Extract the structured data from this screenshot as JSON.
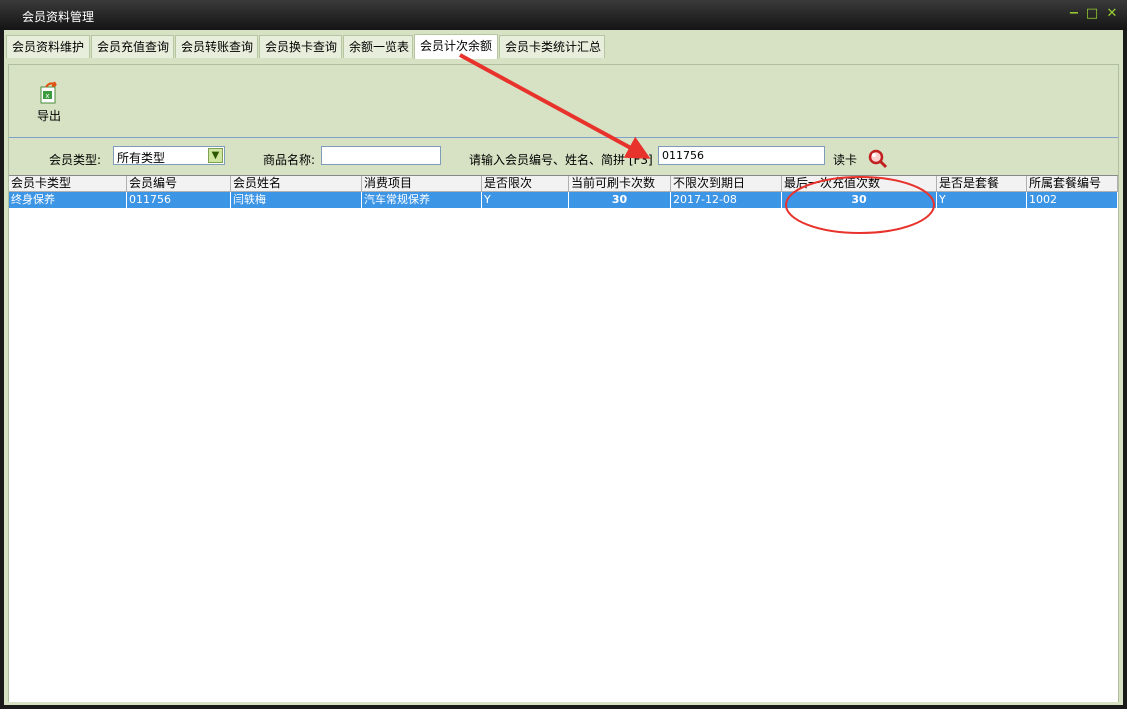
{
  "window": {
    "title": "会员资料管理",
    "min": "−",
    "max": "□",
    "close": "✕"
  },
  "tabs": [
    {
      "label": "会员资料维护"
    },
    {
      "label": "会员充值查询"
    },
    {
      "label": "会员转账查询"
    },
    {
      "label": "会员换卡查询"
    },
    {
      "label": "余额一览表"
    },
    {
      "label": "会员计次余额",
      "active": true
    },
    {
      "label": "会员卡类统计汇总"
    }
  ],
  "toolbar": {
    "export_label": "导出",
    "export_icon": "excel-export-icon"
  },
  "filter": {
    "member_type_label": "会员类型:",
    "member_type_value": "所有类型",
    "product_label": "商品名称:",
    "product_value": "",
    "search_label": "请输入会员编号、姓名、简拼 [F3]",
    "search_value": "011756",
    "read_card_label": "读卡",
    "search_icon": "magnifier-icon"
  },
  "table": {
    "columns": [
      "会员卡类型",
      "会员编号",
      "会员姓名",
      "消费项目",
      "是否限次",
      "当前可刷卡次数",
      "不限次到期日",
      "最后一次充值次数",
      "是否是套餐",
      "所属套餐编号"
    ],
    "rows": [
      [
        "终身保养",
        "011756",
        "闫轶梅",
        "汽车常规保养",
        "Y",
        "30",
        "2017-12-08",
        "30",
        "Y",
        "1002"
      ]
    ]
  },
  "colors": {
    "frame_bg": "#d6e2c3",
    "selection": "#3d95e6",
    "annotation": "#e8322c"
  }
}
